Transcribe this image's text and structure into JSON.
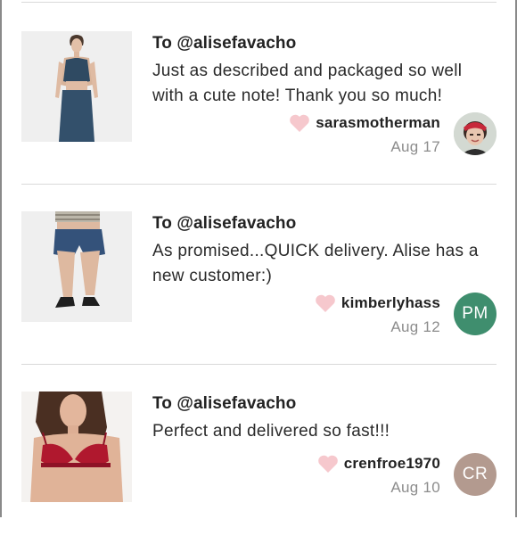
{
  "reviews": [
    {
      "recipient": "To @alisefavacho",
      "comment": "Just as described and packaged so well with a cute note! Thank you so much!",
      "username": "sarasmotherman",
      "date": "Aug 17",
      "avatar_type": "photo",
      "product_icon": "crop-top-and-skirt-photo"
    },
    {
      "recipient": "To @alisefavacho",
      "comment": "As promised...QUICK delivery. Alise has a new customer:)",
      "username": "kimberlyhass",
      "date": "Aug 12",
      "avatar_initials": "PM",
      "avatar_color": "#3f8e6e",
      "product_icon": "denim-shorts-photo"
    },
    {
      "recipient": "To @alisefavacho",
      "comment": "Perfect and delivered so fast!!!",
      "username": "crenfroe1970",
      "date": "Aug 10",
      "avatar_initials": "CR",
      "avatar_color": "#b39a8f",
      "product_icon": "red-lace-bra-photo"
    }
  ],
  "colors": {
    "heart": "#f6c8cd",
    "divider": "#d9d9d9",
    "date_text": "#8c8c8c"
  }
}
